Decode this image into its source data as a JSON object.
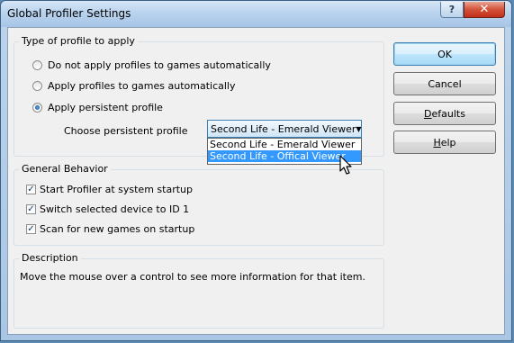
{
  "window": {
    "title": "Global Profiler Settings"
  },
  "titlebar": {
    "help_glyph": "?",
    "close_glyph": "✕"
  },
  "profile_group": {
    "label": "Type of profile to apply",
    "options": [
      {
        "label": "Do not apply profiles to games automatically",
        "checked": false
      },
      {
        "label": "Apply profiles to games automatically",
        "checked": false
      },
      {
        "label": "Apply persistent profile",
        "checked": true
      }
    ],
    "choose_label": "Choose persistent profile",
    "combo_value": "Second Life - Emerald Viewer",
    "dropdown_options": [
      {
        "label": "Second Life - Emerald Viewer",
        "highlighted": false
      },
      {
        "label": "Second Life - Offical Viewer",
        "highlighted": true
      }
    ]
  },
  "general_group": {
    "label": "General Behavior",
    "checkboxes": [
      {
        "label": "Start Profiler at system startup",
        "checked": true
      },
      {
        "label": "Switch selected device to ID 1",
        "checked": true
      },
      {
        "label": "Scan for new games on startup",
        "checked": true
      }
    ]
  },
  "description_group": {
    "label": "Description",
    "text": "Move the mouse over a control to see more information for that item."
  },
  "buttons": {
    "ok": "OK",
    "cancel": "Cancel",
    "defaults_first": "D",
    "defaults_rest": "efaults",
    "help_first": "H",
    "help_rest": "elp"
  },
  "colors": {
    "selection": "#3399ff",
    "default_button_border": "#3c7fb1",
    "close_button": "#c0301a"
  }
}
